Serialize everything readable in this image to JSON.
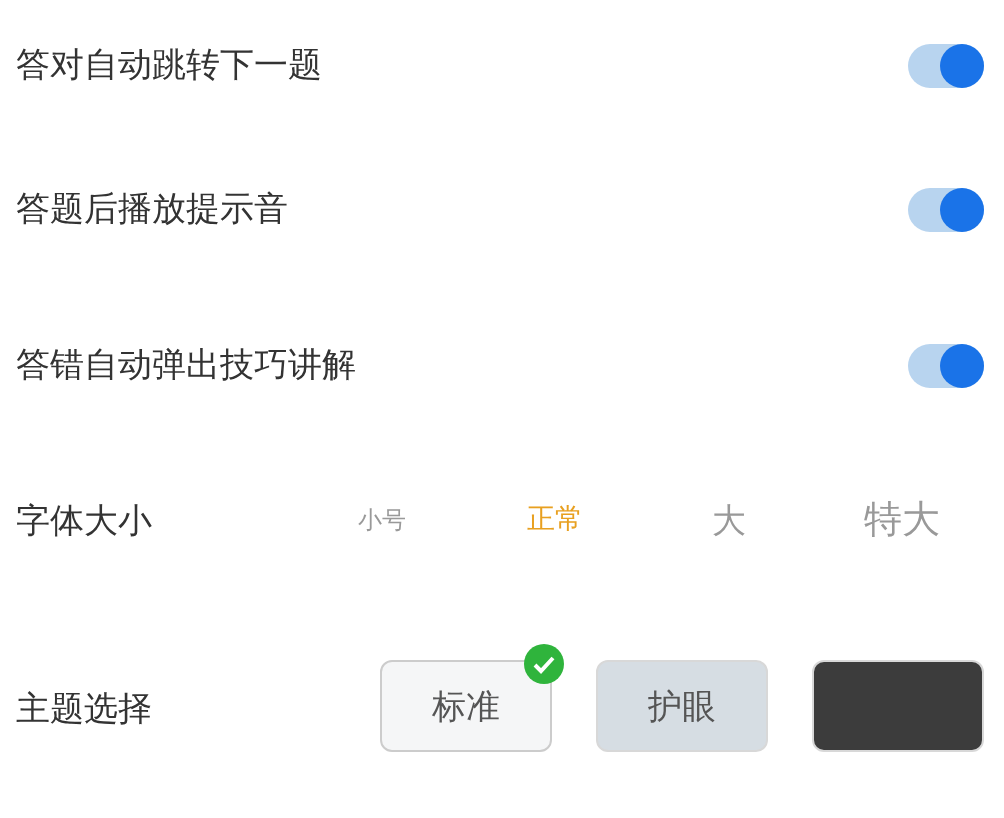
{
  "toggles": [
    {
      "label": "答对自动跳转下一题",
      "on": true
    },
    {
      "label": "答题后播放提示音",
      "on": true
    },
    {
      "label": "答错自动弹出技巧讲解",
      "on": true
    }
  ],
  "font_size": {
    "label": "字体大小",
    "options": [
      {
        "label": "小号",
        "selected": false
      },
      {
        "label": "正常",
        "selected": true
      },
      {
        "label": "大",
        "selected": false
      },
      {
        "label": "特大",
        "selected": false
      }
    ]
  },
  "theme": {
    "label": "主题选择",
    "options": [
      {
        "label": "标准",
        "color": "#f5f6f7",
        "selected": true
      },
      {
        "label": "护眼",
        "color": "#d6dde3",
        "selected": false
      },
      {
        "color": "#3c3c3c",
        "selected": false
      }
    ]
  }
}
